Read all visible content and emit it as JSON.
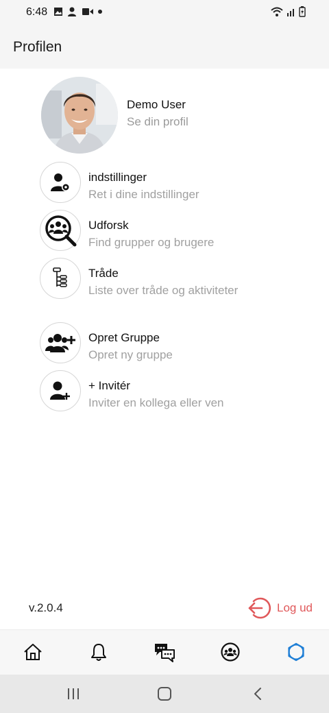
{
  "status_bar": {
    "time": "6:48",
    "left_icons": [
      "image-icon",
      "person-icon",
      "video-icon",
      "dot-icon"
    ],
    "right_icons": [
      "wifi-icon",
      "signal-icon",
      "battery-charging-icon"
    ]
  },
  "header": {
    "title": "Profilen"
  },
  "profile": {
    "name": "Demo User",
    "subtitle": "Se din profil"
  },
  "menu": [
    {
      "title": "indstillinger",
      "subtitle": "Ret i dine indstillinger",
      "icon": "user-settings-icon"
    },
    {
      "title": "Udforsk",
      "subtitle": "Find grupper og brugere",
      "icon": "group-search-icon"
    },
    {
      "title": "Tråde",
      "subtitle": "Liste over tråde og aktiviteter",
      "icon": "thread-tree-icon"
    },
    {
      "title": "Opret Gruppe",
      "subtitle": "Opret ny gruppe",
      "icon": "group-add-icon"
    },
    {
      "title": "+ Invitér",
      "subtitle": "Inviter en kollega eller ven",
      "icon": "user-add-icon"
    }
  ],
  "footer": {
    "version": "v.2.0.4",
    "logout_label": "Log ud"
  },
  "bottom_nav": {
    "items": [
      "home-icon",
      "bell-icon",
      "chat-icon",
      "groups-icon",
      "profile-ring-icon"
    ],
    "active": "profile-ring-icon"
  },
  "colors": {
    "accent_blue": "#1f7fd6",
    "logout_red": "#e0585a",
    "muted_text": "#a0a0a0"
  }
}
